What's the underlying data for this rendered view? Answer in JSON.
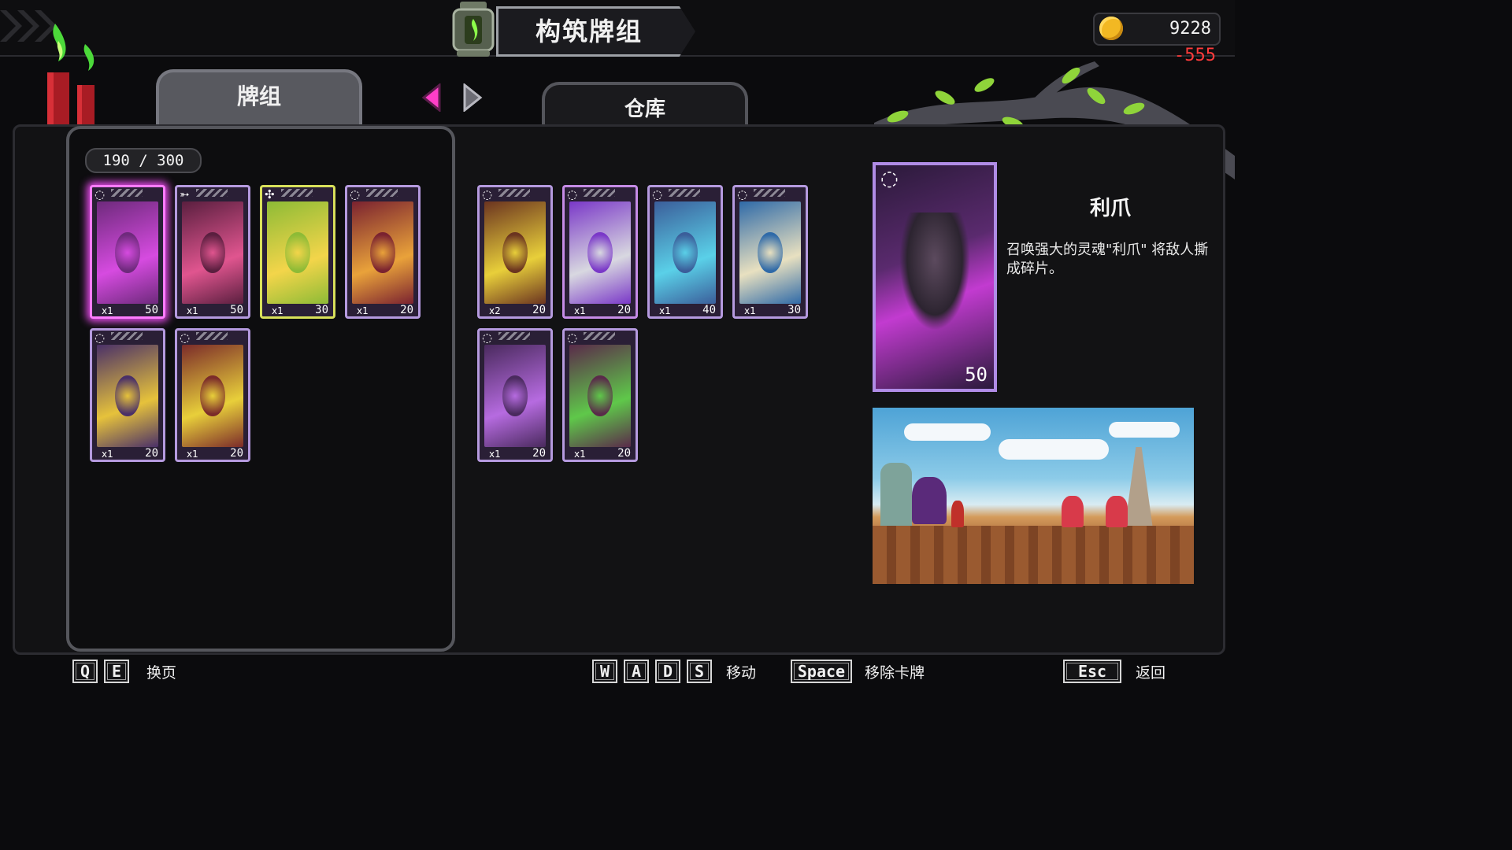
{
  "header": {
    "title": "构筑牌组"
  },
  "currency": {
    "amount": "9228",
    "delta": "-555"
  },
  "tabs": {
    "deck": "牌组",
    "storage": "仓库"
  },
  "deck": {
    "count": "190 / 300",
    "cards": [
      {
        "glyph": "◌",
        "qty": "x1",
        "cost": "50",
        "art": "#6e2a7c",
        "accent": "#d64be0",
        "frame": "#c58be6"
      },
      {
        "glyph": "➳",
        "qty": "x1",
        "cost": "50",
        "art": "#5a1f3f",
        "accent": "#e0558f",
        "frame": "#b59adf"
      },
      {
        "glyph": "✣",
        "qty": "x1",
        "cost": "30",
        "art": "#8dbb36",
        "accent": "#f3d54a",
        "frame": "#d8e05a"
      },
      {
        "glyph": "◌",
        "qty": "x1",
        "cost": "20",
        "art": "#7a2230",
        "accent": "#e9a23a",
        "frame": "#b59adf"
      },
      {
        "glyph": "◌",
        "qty": "x1",
        "cost": "20",
        "art": "#4a3068",
        "accent": "#e6c23b",
        "frame": "#b59adf"
      },
      {
        "glyph": "◌",
        "qty": "x1",
        "cost": "20",
        "art": "#7b2b2a",
        "accent": "#e8cf3a",
        "frame": "#b59adf"
      }
    ]
  },
  "storage": {
    "cards": [
      {
        "glyph": "◌",
        "qty": "x2",
        "cost": "20",
        "art": "#6b3420",
        "accent": "#e8cf3a",
        "frame": "#b59adf"
      },
      {
        "glyph": "◌",
        "qty": "x1",
        "cost": "20",
        "art": "#7a38c8",
        "accent": "#d8d8e0",
        "frame": "#c58be6"
      },
      {
        "glyph": "◌",
        "qty": "x1",
        "cost": "40",
        "art": "#3b5e9a",
        "accent": "#5ad0e8",
        "frame": "#b59adf"
      },
      {
        "glyph": "◌",
        "qty": "x1",
        "cost": "30",
        "art": "#2f6aa8",
        "accent": "#e8e0c0",
        "frame": "#b59adf"
      },
      {
        "glyph": "◌",
        "qty": "x1",
        "cost": "20",
        "art": "#4a2a5e",
        "accent": "#b66be0",
        "frame": "#b59adf"
      },
      {
        "glyph": "◌",
        "qty": "x1",
        "cost": "20",
        "art": "#5a2a4a",
        "accent": "#5fc84a",
        "frame": "#b59adf"
      }
    ]
  },
  "detail": {
    "glyph": "◌",
    "cost": "50",
    "name": "利爪",
    "description": "召唤强大的灵魂\"利爪\" 将敌人撕成碎片。"
  },
  "controls": {
    "page_keys": [
      "Q",
      "E"
    ],
    "page_label": "换页",
    "move_keys": [
      "W",
      "A",
      "D",
      "S"
    ],
    "move_label": "移动",
    "remove_key": "Space",
    "remove_label": "移除卡牌",
    "back_key": "Esc",
    "back_label": "返回"
  },
  "colors": {
    "accent": "#e24ae6",
    "coin": "#f2b823",
    "delta": "#ff3b3b"
  },
  "icons": [
    "chevron-left-icon",
    "chevron-right-icon",
    "coin-icon",
    "lantern-icon",
    "candle-icon",
    "branch-decoration"
  ]
}
